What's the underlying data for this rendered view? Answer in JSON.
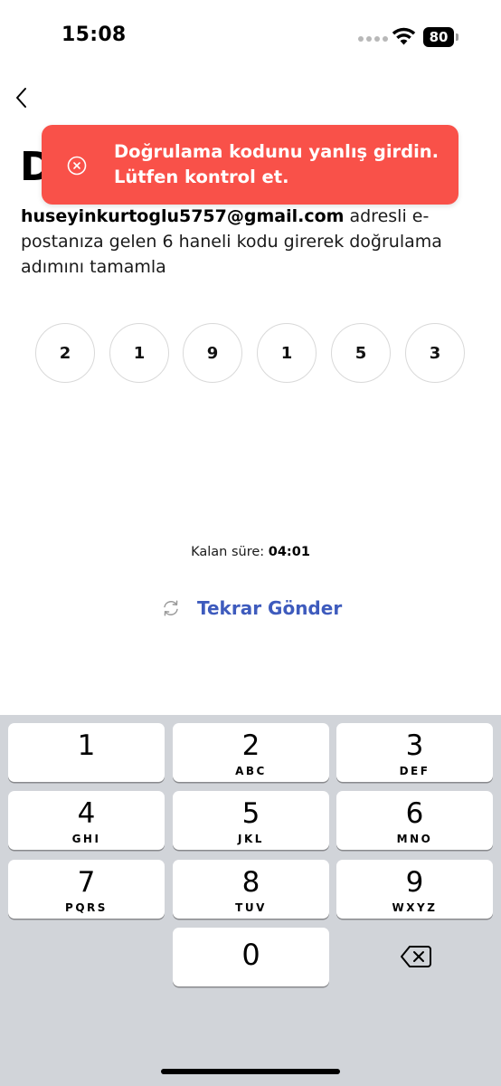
{
  "status_bar": {
    "time": "15:08",
    "battery_percent": "80"
  },
  "header": {
    "title_visible": "D"
  },
  "toast": {
    "message_line1": "Doğrulama kodunu yanlış girdin.",
    "message_line2": "Lütfen kontrol et.",
    "background_color": "#f95149",
    "icon": "error-circle-x-icon"
  },
  "description": {
    "email": "huseyinkurtoglu5757@gmail.com",
    "text": " adresli e-postanıza gelen 6 haneli kodu girerek doğrulama adımını tamamla"
  },
  "code": {
    "digits": [
      "2",
      "1",
      "9",
      "1",
      "5",
      "3"
    ]
  },
  "timer": {
    "label": "Kalan süre: ",
    "value": "04:01"
  },
  "resend": {
    "label": "Tekrar Gönder",
    "color": "#3e5bbd",
    "icon": "refresh-icon"
  },
  "keyboard": {
    "keys": [
      {
        "digit": "1",
        "letters": ""
      },
      {
        "digit": "2",
        "letters": "ABC"
      },
      {
        "digit": "3",
        "letters": "DEF"
      },
      {
        "digit": "4",
        "letters": "GHI"
      },
      {
        "digit": "5",
        "letters": "JKL"
      },
      {
        "digit": "6",
        "letters": "MNO"
      },
      {
        "digit": "7",
        "letters": "PQRS"
      },
      {
        "digit": "8",
        "letters": "TUV"
      },
      {
        "digit": "9",
        "letters": "WXYZ"
      },
      {
        "digit": "0",
        "letters": ""
      }
    ],
    "delete_icon": "backspace-icon"
  }
}
